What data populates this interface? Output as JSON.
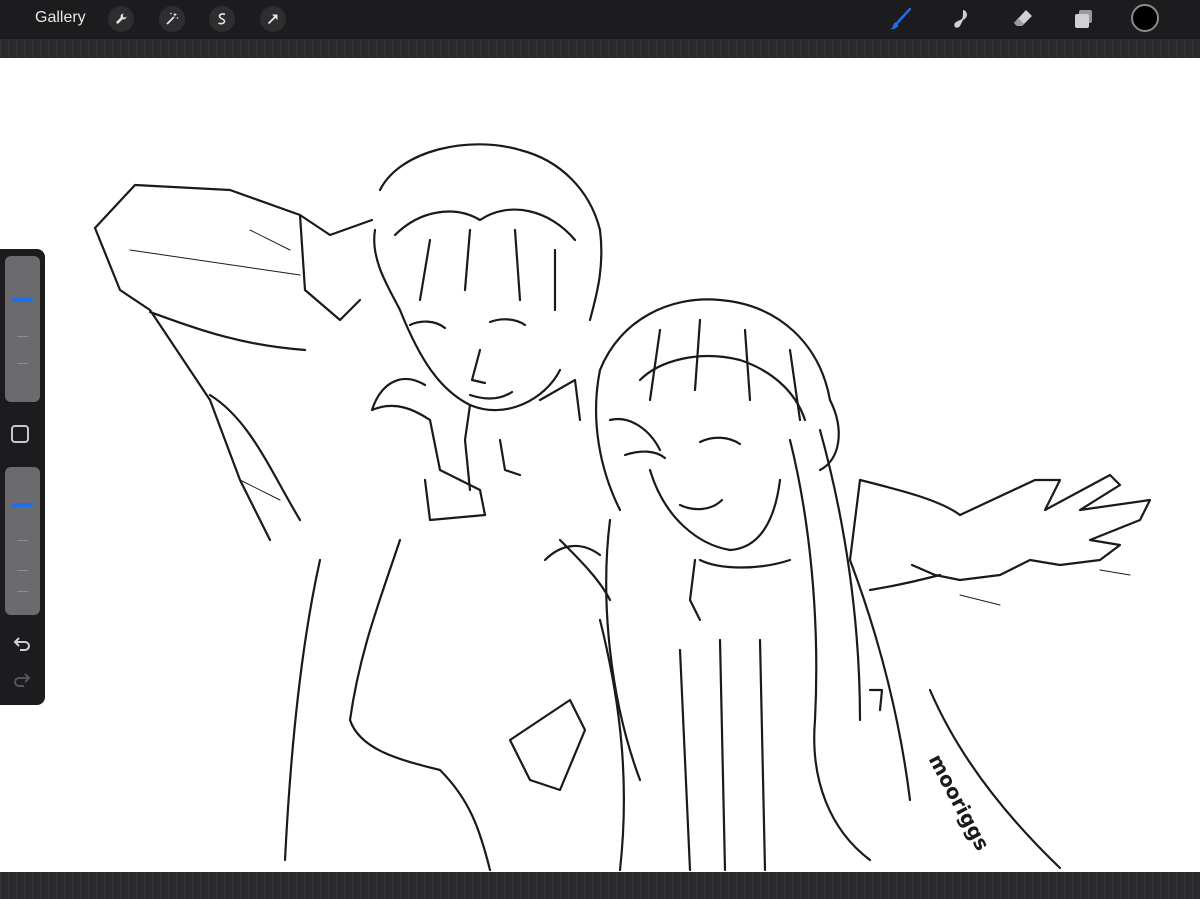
{
  "topbar": {
    "gallery_label": "Gallery",
    "left_tools": [
      "wrench-icon",
      "magic-wand-icon",
      "selection-icon",
      "transform-arrow-icon"
    ],
    "right_tools": [
      "brush-icon",
      "smudge-icon",
      "eraser-icon",
      "layers-icon",
      "color-swatch"
    ],
    "active_tool": "brush-icon",
    "accent_color": "#1e6ff0",
    "current_color": "#000000"
  },
  "sidebar": {
    "brush_size_level": 0.85,
    "opacity_level": 0.8,
    "buttons": [
      "modify-button",
      "undo-button",
      "redo-button"
    ]
  },
  "canvas": {
    "signature": "mooriggs"
  }
}
